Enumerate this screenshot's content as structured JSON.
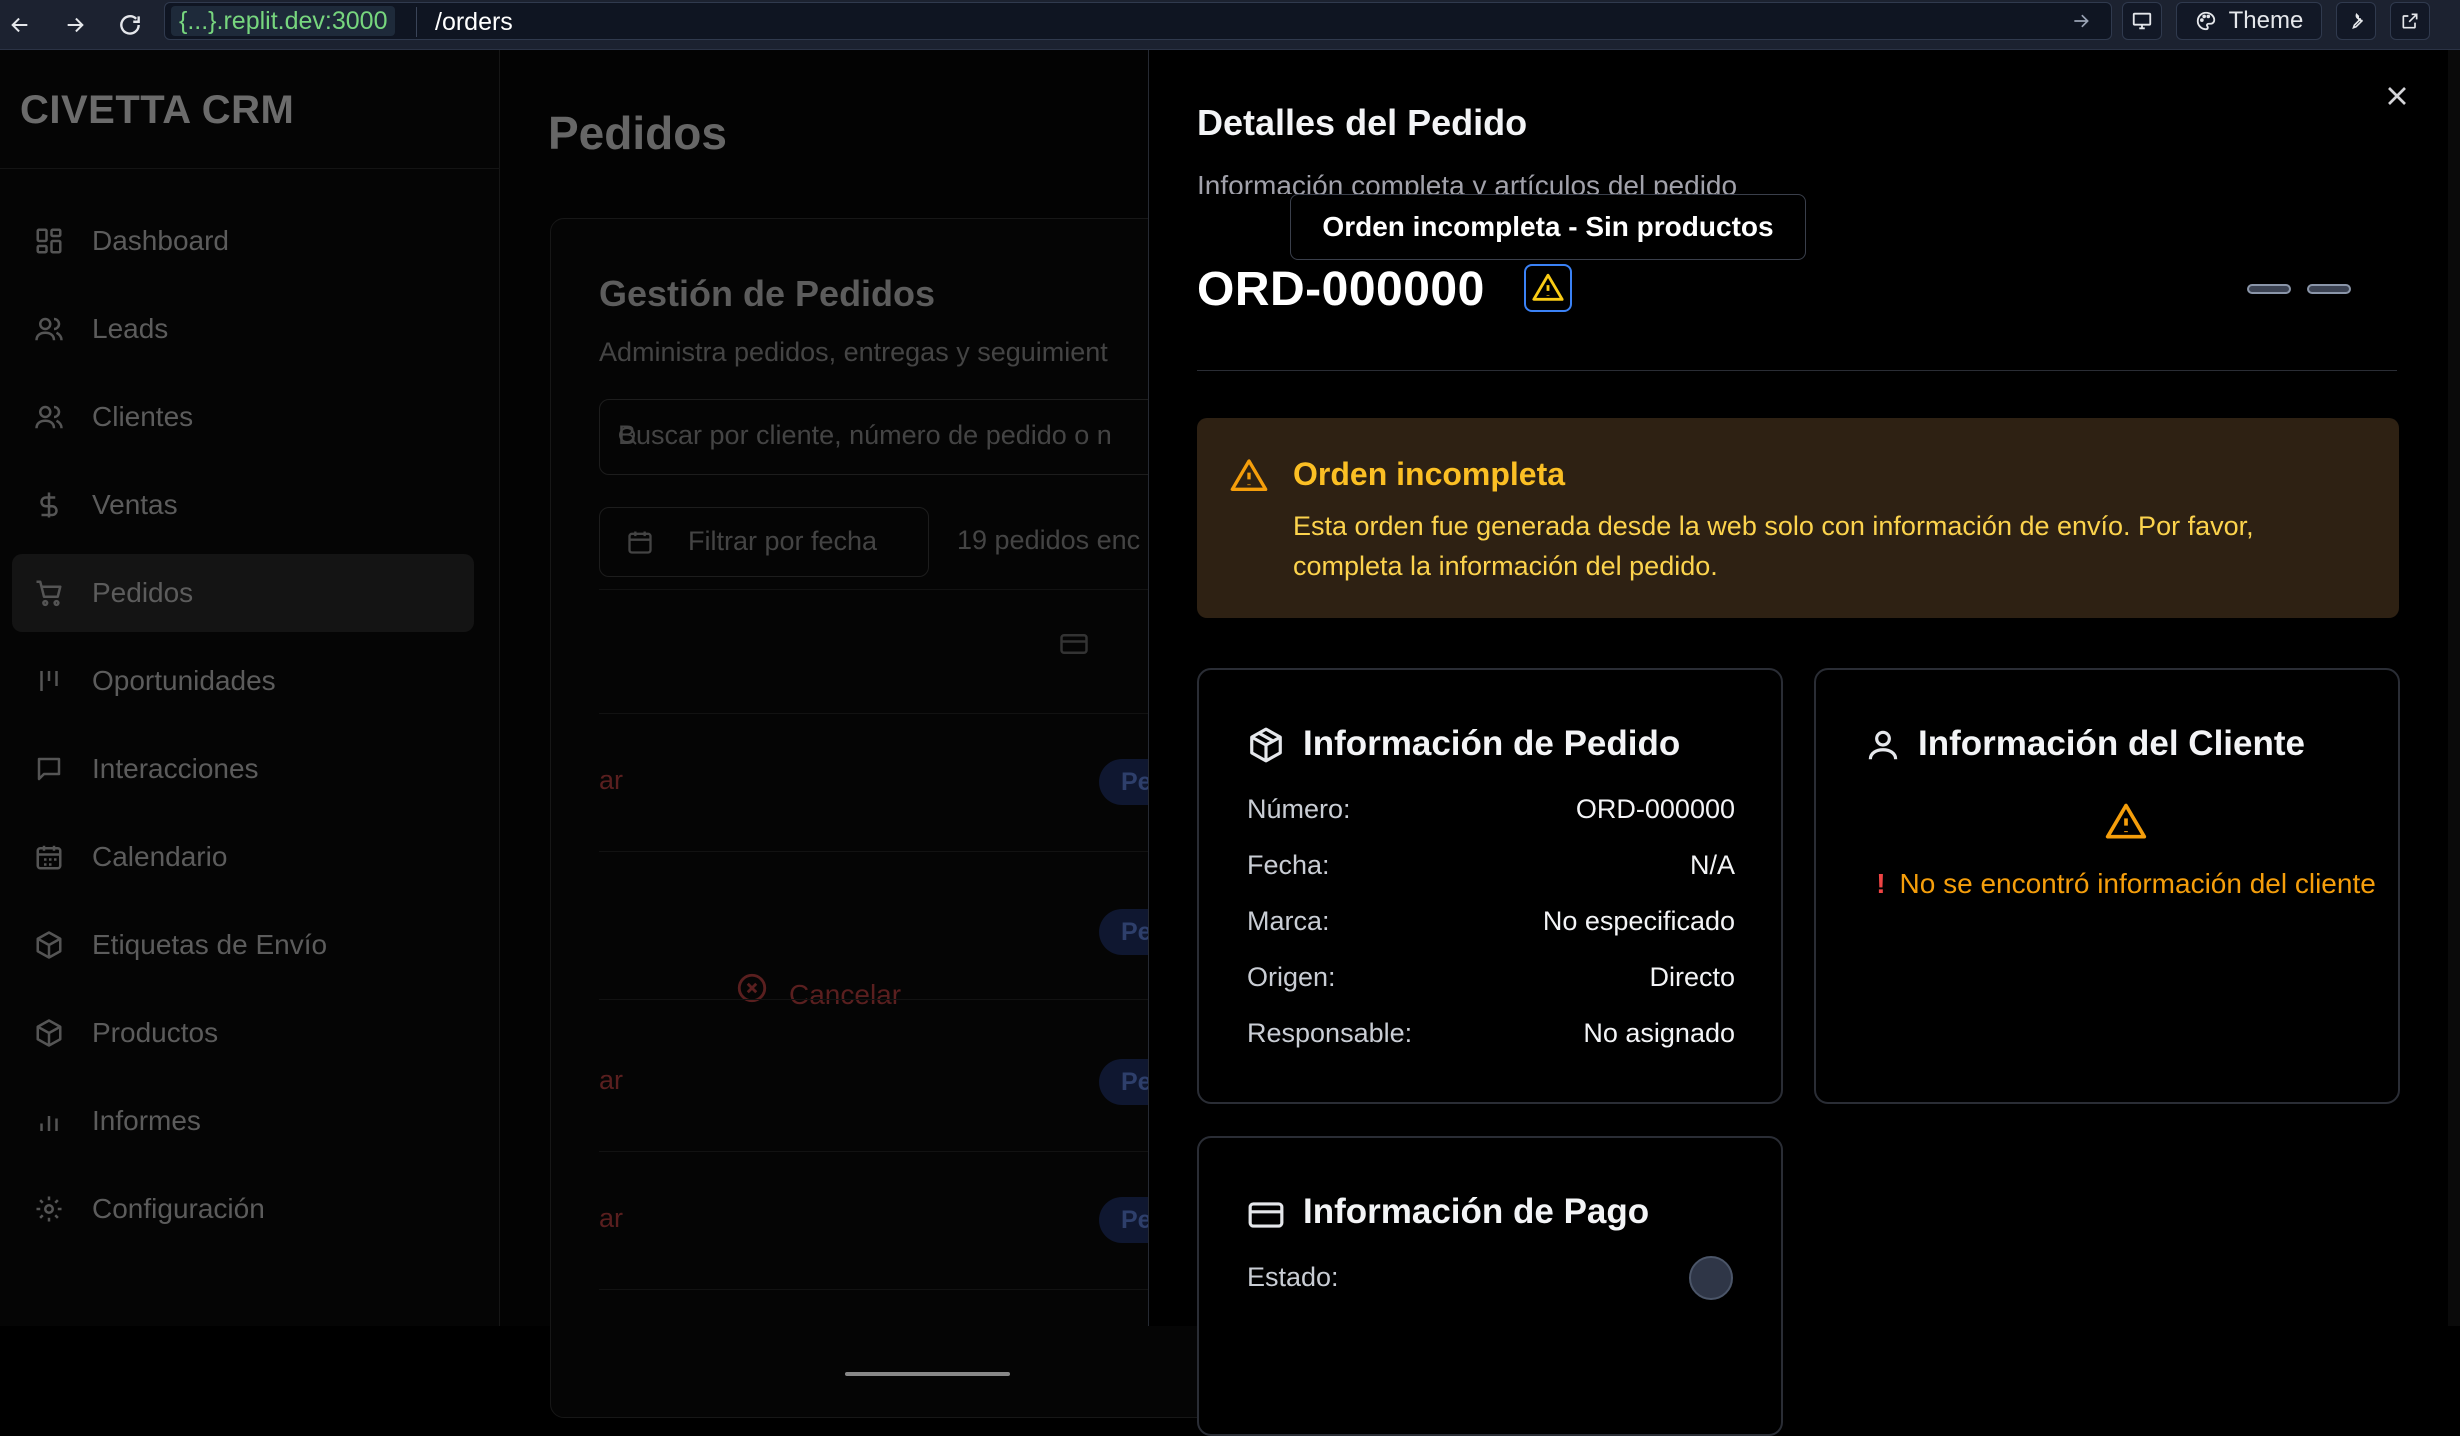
{
  "browser": {
    "url_host": "{...}.replit.dev:3000",
    "url_path": "/orders",
    "theme_label": "Theme"
  },
  "sidebar": {
    "brand": "CIVETTA CRM",
    "items": [
      {
        "label": "Dashboard",
        "icon": "grid-icon"
      },
      {
        "label": "Leads",
        "icon": "users-icon"
      },
      {
        "label": "Clientes",
        "icon": "users-icon"
      },
      {
        "label": "Ventas",
        "icon": "dollar-icon"
      },
      {
        "label": "Pedidos",
        "icon": "cart-icon",
        "active": true
      },
      {
        "label": "Oportunidades",
        "icon": "bars-icon"
      },
      {
        "label": "Interacciones",
        "icon": "message-icon"
      },
      {
        "label": "Calendario",
        "icon": "calendar-icon"
      },
      {
        "label": "Etiquetas de Envío",
        "icon": "package-icon"
      },
      {
        "label": "Productos",
        "icon": "package-icon"
      },
      {
        "label": "Informes",
        "icon": "chart-icon"
      },
      {
        "label": "Configuración",
        "icon": "gear-icon"
      }
    ]
  },
  "main": {
    "title": "Pedidos",
    "card_title": "Gestión de Pedidos",
    "card_desc": "Administra pedidos, entregas y seguimient",
    "search_placeholder": "Buscar por cliente, número de pedido o n",
    "date_filter": "Filtrar por fecha",
    "count": "19 pedidos enc",
    "row_action": "ar",
    "row_badge": "Pendie",
    "cancel_label": "Cancelar"
  },
  "dialog": {
    "title": "Detalles del Pedido",
    "subtitle": "Información completa y artículos del pedido",
    "order_number": "ORD-000000",
    "tooltip": "Orden incompleta - Sin productos",
    "alert": {
      "title": "Orden incompleta",
      "body": "Esta orden fue generada desde la web solo con información de envío. Por favor, completa la información del pedido."
    },
    "order_info": {
      "title": "Información de Pedido",
      "rows": [
        {
          "k": "Número:",
          "v": "ORD-000000"
        },
        {
          "k": "Fecha:",
          "v": "N/A"
        },
        {
          "k": "Marca:",
          "v": "No especificado"
        },
        {
          "k": "Origen:",
          "v": "Directo"
        },
        {
          "k": "Responsable:",
          "v": "No asignado"
        }
      ]
    },
    "customer_info": {
      "title": "Información del Cliente",
      "excl": "!",
      "message": "No se encontró información del cliente"
    },
    "payment_info": {
      "title": "Información de Pago",
      "status_label": "Estado:"
    }
  }
}
